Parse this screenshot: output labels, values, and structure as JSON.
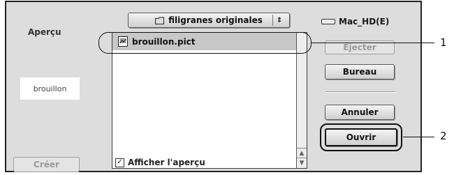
{
  "dialog": {
    "preview": {
      "title": "Aperçu",
      "thumbnail_text": "brouillon",
      "create_button": "Créer"
    },
    "folder_popup": {
      "label": "filigranes originales",
      "arrows_glyph": "⇕"
    },
    "file_list": {
      "items": [
        {
          "name": "brouillon.pict",
          "selected": true
        }
      ]
    },
    "show_preview": {
      "label": "Afficher l'aperçu",
      "checked": true,
      "check_glyph": "✓"
    },
    "disk": {
      "name": "Mac_HD(E)"
    },
    "buttons": {
      "eject": "Éjecter",
      "desktop": "Bureau",
      "cancel": "Annuler",
      "open": "Ouvrir"
    },
    "scroll": {
      "up_glyph": "▲",
      "down_glyph": "▼"
    }
  },
  "callouts": {
    "one": "1",
    "two": "2"
  }
}
